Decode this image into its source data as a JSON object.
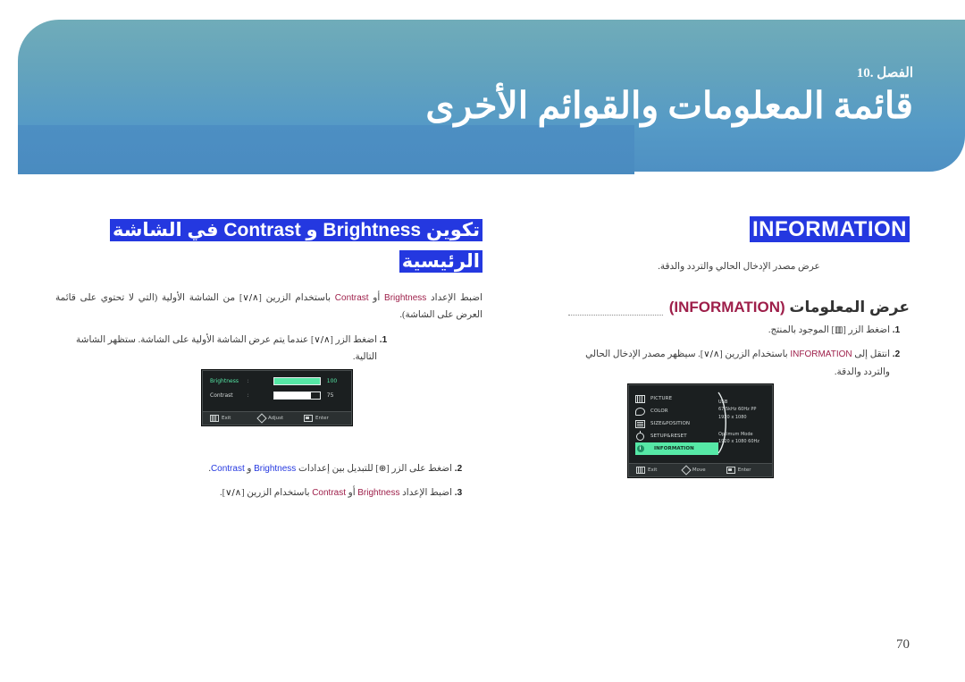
{
  "header": {
    "chapter_label": "الفصل .10",
    "title": "قائمة المعلومات والقوائم الأخرى",
    "gradient_top": "#70acb9",
    "gradient_bottom": "#4c8ec2"
  },
  "left_column": {
    "heading_line1": "تكوين Brightness و Contrast في الشاشة",
    "heading_line2": "الرئيسية",
    "intro_prefix": "اضبط الإعداد ",
    "intro_brightness": "Brightness",
    "intro_or": " أو ",
    "intro_contrast": "Contrast",
    "intro_mid": " باستخدام الزرين [",
    "intro_keys": "∧/∨",
    "intro_suffix": "] من الشاشة الأولية (التي لا تحتوي على قائمة العرض على الشاشة).",
    "steps": [
      {
        "n": "1",
        "pre": "اضغط الزر [",
        "key": "∧/∨",
        "post": "] عندما يتم عرض الشاشة الأولية على الشاشة. ستظهر الشاشة التالية."
      },
      {
        "n": "2",
        "pre": "اضغط على الزر [",
        "key": "⊕",
        "post": "] للتبديل بين إعدادات ",
        "en1": "Brightness",
        "mid": " و ",
        "en2": "Contrast",
        "end": "."
      },
      {
        "n": "3",
        "pre": "اضبط الإعداد ",
        "en1": "Brightness",
        "mid": " أو ",
        "en2": "Contrast",
        "post": " باستخدام الزرين [",
        "key": "∧/∨",
        "end": "]."
      }
    ],
    "osd": {
      "rows": [
        {
          "label": "Brightness",
          "colon": ":",
          "value": "100",
          "fill_pct": 100,
          "selected": true
        },
        {
          "label": "Contrast",
          "colon": ":",
          "value": "75",
          "fill_pct": 75,
          "selected": false
        }
      ],
      "bar": [
        {
          "icon": "menu-icon",
          "label": "Exit"
        },
        {
          "icon": "diamond-icon",
          "label": "Adjust"
        },
        {
          "icon": "enter-icon",
          "label": "Enter"
        }
      ]
    }
  },
  "right_column": {
    "badge": "INFORMATION",
    "description": "عرض مصدر الإدخال الحالي والتردد والدقة.",
    "sub_heading_ar": "عرض المعلومات ",
    "sub_heading_en": "(INFORMATION)",
    "steps": [
      {
        "n": "1",
        "pre": "اضغط الزر [",
        "key": "▥",
        "post": "] الموجود بالمنتج."
      },
      {
        "n": "2",
        "pre": "انتقل إلى ",
        "en1": "INFORMATION",
        "mid": " باستخدام الزرين [",
        "key": "∧/∨",
        "post": "]. سيظهر مصدر الإدخال الحالي والتردد والدقة."
      }
    ],
    "osd": {
      "menu_items": [
        {
          "icon": "picture-icon",
          "label": "PICTURE",
          "active": false
        },
        {
          "icon": "color-icon",
          "label": "COLOR",
          "active": false
        },
        {
          "icon": "size-position-icon",
          "label": "SIZE&POSITION",
          "active": false
        },
        {
          "icon": "setup-reset-icon",
          "label": "SETUP&RESET",
          "active": false
        },
        {
          "icon": "information-icon",
          "label": "INFORMATION",
          "active": true
        }
      ],
      "info_panel": {
        "source": "USB",
        "frequency": "67.5kHz 60Hz PP",
        "resolution": "1920 x 1080",
        "optimum_label": "Optimum Mode",
        "optimum_value": "1920 x 1080  60Hz"
      },
      "bar": [
        {
          "icon": "menu-icon",
          "label": "Exit"
        },
        {
          "icon": "diamond-icon",
          "label": "Move"
        },
        {
          "icon": "enter-icon",
          "label": "Enter"
        }
      ]
    }
  },
  "footer": {
    "page_number": "70"
  },
  "colors": {
    "highlight_blue": "#2438e0",
    "accent_maroon": "#9e1f4a",
    "osd_green": "#56e8a6"
  }
}
